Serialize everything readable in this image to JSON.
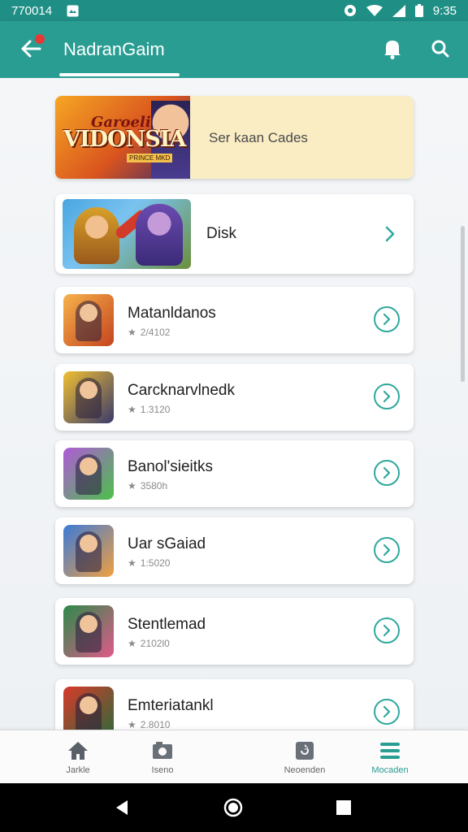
{
  "status_bar": {
    "left_text": "770014",
    "time": "9:35"
  },
  "app_bar": {
    "title": "NadranGaim"
  },
  "banner": {
    "logo_top": "Garoeli",
    "logo_main": "VIDONSIA",
    "logo_sub": "PRINCE MKD",
    "text": "Ser kaan Cades"
  },
  "featured": {
    "label": "Disk"
  },
  "games": [
    {
      "name": "Matanldanos",
      "meta": "2/4102",
      "icon": "game-icon-hero-boy",
      "colors": [
        "#f7b24a",
        "#c4441e"
      ]
    },
    {
      "name": "Carcknarvlnedk",
      "meta": "1.3120",
      "icon": "game-icon-mech",
      "colors": [
        "#f0c032",
        "#3a3a6b"
      ]
    },
    {
      "name": "Banol'sieitks",
      "meta": "3580h",
      "icon": "game-icon-puzzle",
      "colors": [
        "#b05ad8",
        "#4bc04a"
      ]
    },
    {
      "name": "Uar sGaiad",
      "meta": "1:5020",
      "icon": "game-icon-warrior",
      "colors": [
        "#3c7ad8",
        "#f0a040"
      ]
    },
    {
      "name": "Stentlemad",
      "meta": "2102l0",
      "icon": "game-icon-girl",
      "colors": [
        "#2c8a4a",
        "#e05a8a"
      ]
    },
    {
      "name": "Emteriatankl",
      "meta": "2.8010",
      "icon": "game-icon-knight",
      "colors": [
        "#d83a2a",
        "#2a6b3a"
      ]
    }
  ],
  "bottom_nav": [
    {
      "label": "Jarkle",
      "icon": "home-icon",
      "active": false
    },
    {
      "label": "Iseno",
      "icon": "gallery-icon",
      "active": false
    },
    {
      "label": "Neoenden",
      "icon": "refresh-icon",
      "active": false
    },
    {
      "label": "Mocaden",
      "icon": "menu-icon",
      "active": true
    }
  ],
  "colors": {
    "primary": "#2a9d93",
    "status_bar": "#1f8f86",
    "banner_bg": "#faedc4",
    "accent_ring": "#2ea89d"
  }
}
